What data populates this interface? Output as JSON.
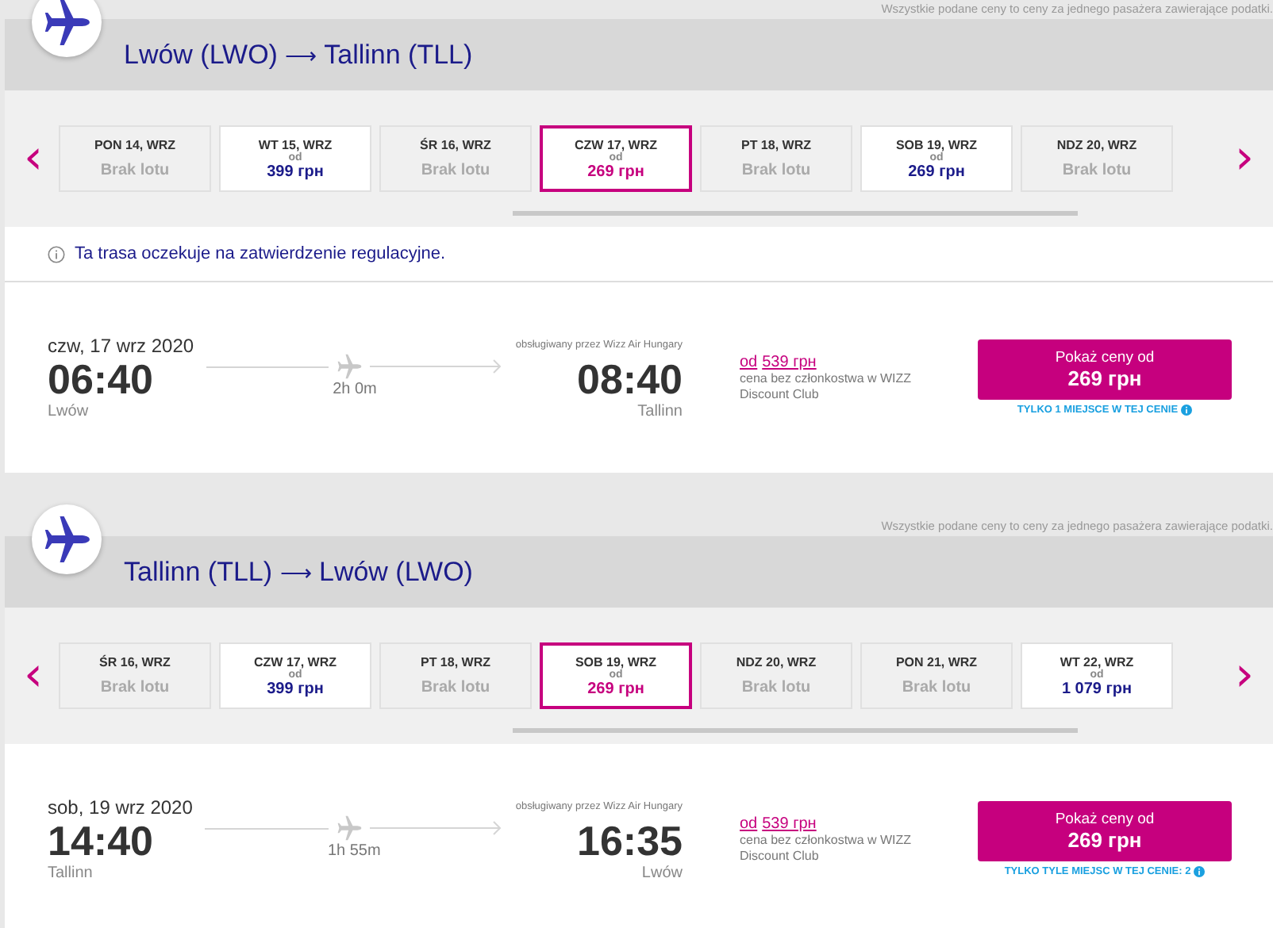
{
  "sections": [
    {
      "note": "Wszystkie podane ceny to ceny za jednego pasażera zawierające podatki.",
      "route": {
        "from": "Lwów (LWO)",
        "arrow": "⟶",
        "to": "Tallinn (TLL)"
      },
      "prev": "‹",
      "next": "›",
      "dates": [
        {
          "label": "PON 14, WRZ",
          "kind": "unavailable",
          "text": "Brak lotu",
          "selected": false
        },
        {
          "label": "WT 15, WRZ",
          "kind": "available",
          "od": "od",
          "text": "399 грн",
          "selected": false
        },
        {
          "label": "ŚR 16, WRZ",
          "kind": "unavailable",
          "text": "Brak lotu",
          "selected": false
        },
        {
          "label": "CZW 17, WRZ",
          "kind": "available",
          "od": "od",
          "text": "269 грн",
          "selected": true
        },
        {
          "label": "PT 18, WRZ",
          "kind": "unavailable",
          "text": "Brak lotu",
          "selected": false
        },
        {
          "label": "SOB 19, WRZ",
          "kind": "available",
          "od": "od",
          "text": "269 грн",
          "selected": false
        },
        {
          "label": "NDZ 20, WRZ",
          "kind": "unavailable",
          "text": "Brak lotu",
          "selected": false
        }
      ],
      "notice": "Ta trasa oczekuje na zatwierdzenie regulacyjne.",
      "flight": {
        "date": "czw, 17 wrz 2020",
        "operator": "obsługiwany przez Wizz Air Hungary",
        "departure_time": "06:40",
        "departure_city": "Lwów",
        "duration": "2h 0m",
        "arrival_time": "08:40",
        "arrival_city": "Tallinn",
        "od": "od",
        "regular_price": "539 грн",
        "regular_note": "cena bez członkostwa w WIZZ Discount Club",
        "button_label": "Pokaż ceny od",
        "button_price": "269 грн",
        "availability": "TYLKO 1 MIEJSCE W TEJ CENIE"
      }
    },
    {
      "note": "Wszystkie podane ceny to ceny za jednego pasażera zawierające podatki.",
      "route": {
        "from": "Tallinn (TLL)",
        "arrow": "⟶",
        "to": "Lwów (LWO)"
      },
      "prev": "‹",
      "next": "›",
      "dates": [
        {
          "label": "ŚR 16, WRZ",
          "kind": "unavailable",
          "text": "Brak lotu",
          "selected": false
        },
        {
          "label": "CZW 17, WRZ",
          "kind": "available",
          "od": "od",
          "text": "399 грн",
          "selected": false
        },
        {
          "label": "PT 18, WRZ",
          "kind": "unavailable",
          "text": "Brak lotu",
          "selected": false
        },
        {
          "label": "SOB 19, WRZ",
          "kind": "available",
          "od": "od",
          "text": "269 грн",
          "selected": true
        },
        {
          "label": "NDZ 20, WRZ",
          "kind": "unavailable",
          "text": "Brak lotu",
          "selected": false
        },
        {
          "label": "PON 21, WRZ",
          "kind": "unavailable",
          "text": "Brak lotu",
          "selected": false
        },
        {
          "label": "WT 22, WRZ",
          "kind": "available",
          "od": "od",
          "text": "1 079 грн",
          "selected": false
        }
      ],
      "flight": {
        "date": "sob, 19 wrz 2020",
        "operator": "obsługiwany przez Wizz Air Hungary",
        "departure_time": "14:40",
        "departure_city": "Tallinn",
        "duration": "1h 55m",
        "arrival_time": "16:35",
        "arrival_city": "Lwów",
        "od": "od",
        "regular_price": "539 грн",
        "regular_note": "cena bez członkostwa w WIZZ Discount Club",
        "button_label": "Pokaż ceny od",
        "button_price": "269 грн",
        "availability": "TYLKO TYLE MIEJSC W TEJ CENIE: 2"
      }
    }
  ]
}
